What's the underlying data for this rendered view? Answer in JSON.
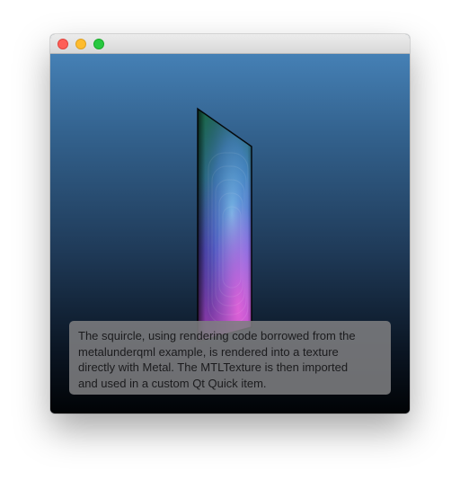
{
  "window": {
    "title": "",
    "buttons": {
      "close": {
        "icon": "close-dot-icon",
        "color": "#fe5f57"
      },
      "minimize": {
        "icon": "minimize-dot-icon",
        "color": "#febc2e"
      },
      "zoom": {
        "icon": "zoom-dot-icon",
        "color": "#28c840"
      }
    }
  },
  "scene": {
    "background_top": "#4580b5",
    "background_bottom": "#010305",
    "texture_item": "squircle-texture"
  },
  "caption": {
    "text": "The squircle, using rendering code borrowed from the\nmetalunderqml example, is rendered into a texture\ndirectly with Metal. The MTLTexture is then imported\nand used in a custom Qt Quick item."
  }
}
